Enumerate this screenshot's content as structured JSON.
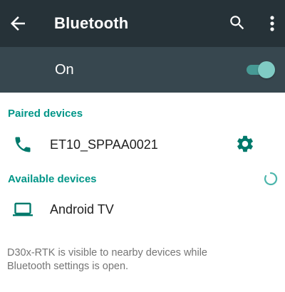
{
  "appbar": {
    "title": "Bluetooth",
    "back_icon": "arrow-back-icon",
    "search_icon": "search-icon",
    "more_icon": "more-vert-icon"
  },
  "master_switch": {
    "label": "On",
    "checked": true
  },
  "paired": {
    "header": "Paired devices",
    "devices": [
      {
        "name": "ET10_SPPAA0021",
        "icon": "phone-icon",
        "settings_icon": "gear-icon"
      }
    ]
  },
  "available": {
    "header": "Available devices",
    "progress_icon": "progress-spinner-icon",
    "devices": [
      {
        "name": "Android TV",
        "icon": "laptop-icon"
      }
    ]
  },
  "footer": {
    "text": "D30x-RTK is visible to nearby devices while Bluetooth settings is open."
  },
  "colors": {
    "appbar_bg": "#263238",
    "switch_bar_bg": "#37474F",
    "accent": "#009688",
    "toggle_thumb": "#80CBC4"
  }
}
